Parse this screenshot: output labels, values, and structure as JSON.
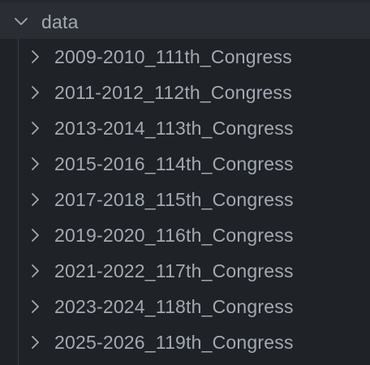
{
  "explorer": {
    "folder": {
      "label": "data",
      "expanded": true,
      "icon": "chevron-down-icon"
    },
    "items": [
      {
        "label": "2009-2010_111th_Congress",
        "icon": "chevron-right-icon"
      },
      {
        "label": "2011-2012_112th_Congress",
        "icon": "chevron-right-icon"
      },
      {
        "label": "2013-2014_113th_Congress",
        "icon": "chevron-right-icon"
      },
      {
        "label": "2015-2016_114th_Congress",
        "icon": "chevron-right-icon"
      },
      {
        "label": "2017-2018_115th_Congress",
        "icon": "chevron-right-icon"
      },
      {
        "label": "2019-2020_116th_Congress",
        "icon": "chevron-right-icon"
      },
      {
        "label": "2021-2022_117th_Congress",
        "icon": "chevron-right-icon"
      },
      {
        "label": "2023-2024_118th_Congress",
        "icon": "chevron-right-icon"
      },
      {
        "label": "2025-2026_119th_Congress",
        "icon": "chevron-right-icon"
      }
    ],
    "colors": {
      "background": "#1f2227",
      "selected_row": "#2a2e34",
      "text": "#a3a9b3",
      "indent_guide": "#3a3e45"
    }
  }
}
